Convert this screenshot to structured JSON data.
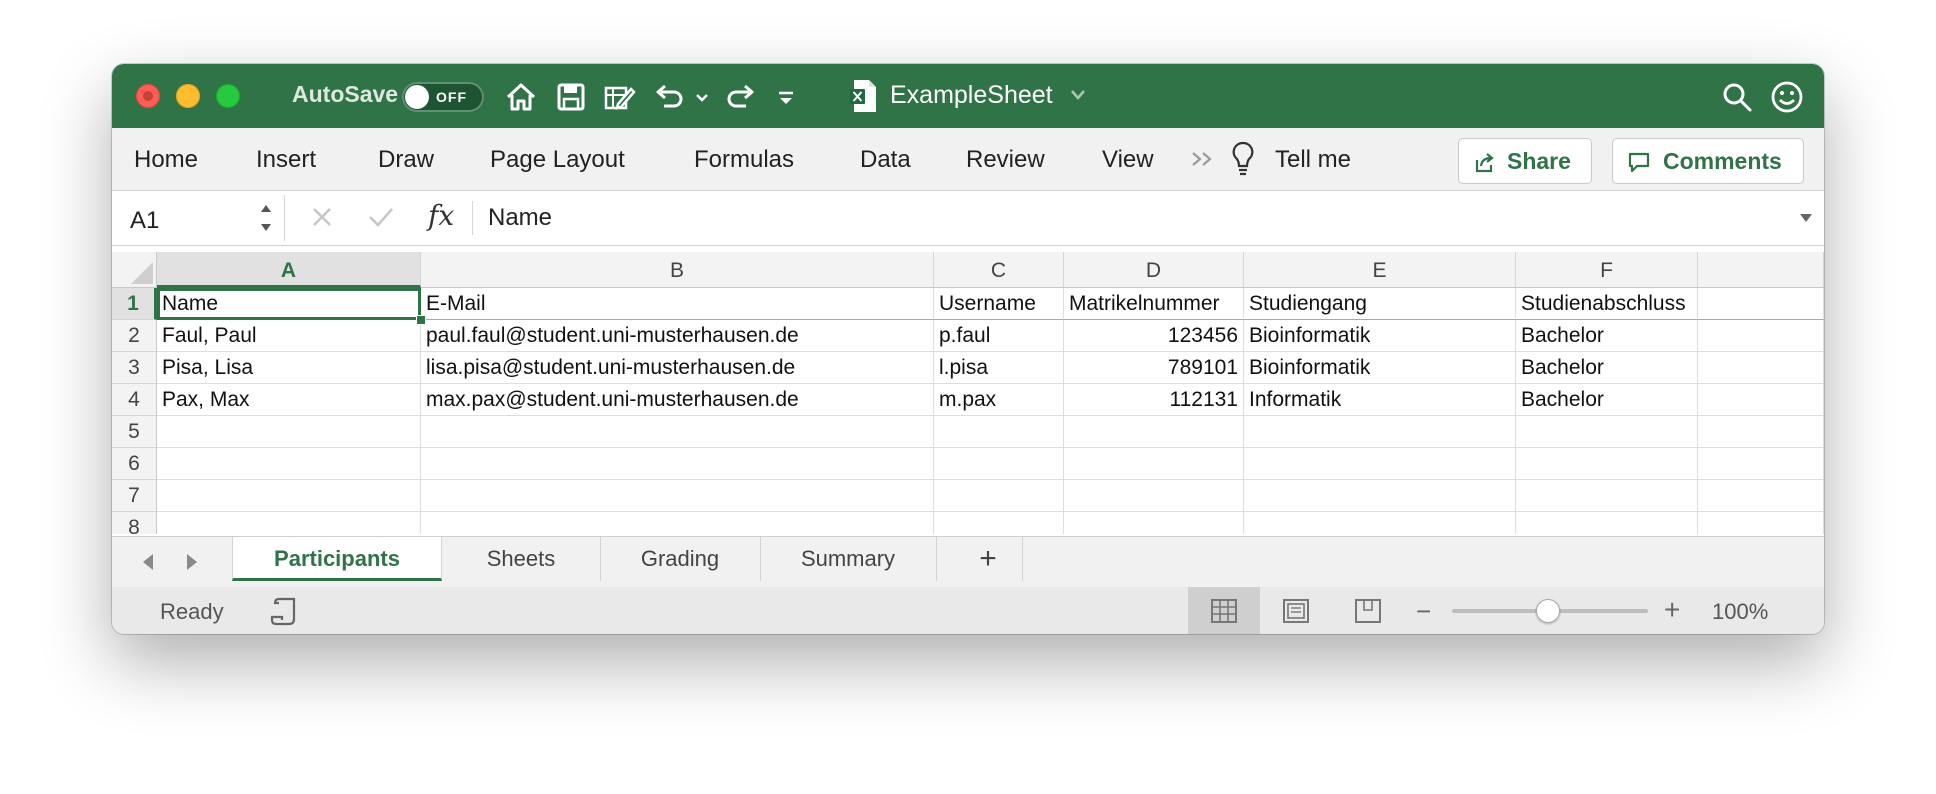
{
  "titlebar": {
    "autosave_label": "AutoSave",
    "autosave_state": "OFF",
    "document_title": "ExampleSheet",
    "colors": {
      "bar": "#2f7347",
      "close": "#fd5f57",
      "minimize": "#febc2e",
      "maximize": "#28c840"
    }
  },
  "ribbon": {
    "tabs": [
      "Home",
      "Insert",
      "Draw",
      "Page Layout",
      "Formulas",
      "Data",
      "Review",
      "View"
    ],
    "tell_me": "Tell me",
    "share_label": "Share",
    "comments_label": "Comments"
  },
  "formula_bar": {
    "name_box": "A1",
    "fx_label": "fx",
    "content": "Name"
  },
  "sheet": {
    "columns": [
      "A",
      "B",
      "C",
      "D",
      "E",
      "F"
    ],
    "rows": [
      "1",
      "2",
      "3",
      "4",
      "5",
      "6",
      "7",
      "8"
    ],
    "active_cell": "A1",
    "cells": [
      [
        "Name",
        "E-Mail",
        "Username",
        "Matrikelnummer",
        "Studiengang",
        "Studienabschluss"
      ],
      [
        "Faul, Paul",
        "paul.faul@student.uni-musterhausen.de",
        "p.faul",
        "123456",
        "Bioinformatik",
        "Bachelor"
      ],
      [
        "Pisa, Lisa",
        "lisa.pisa@student.uni-musterhausen.de",
        "l.pisa",
        "789101",
        "Bioinformatik",
        "Bachelor"
      ],
      [
        "Pax, Max",
        "max.pax@student.uni-musterhausen.de",
        "m.pax",
        "112131",
        "Informatik",
        "Bachelor"
      ]
    ]
  },
  "sheet_tabs": {
    "tabs": [
      "Participants",
      "Sheets",
      "Grading",
      "Summary"
    ],
    "active": "Participants",
    "add_label": "+"
  },
  "status_bar": {
    "status": "Ready",
    "zoom": "100%",
    "zoom_minus": "−",
    "zoom_plus": "+"
  }
}
